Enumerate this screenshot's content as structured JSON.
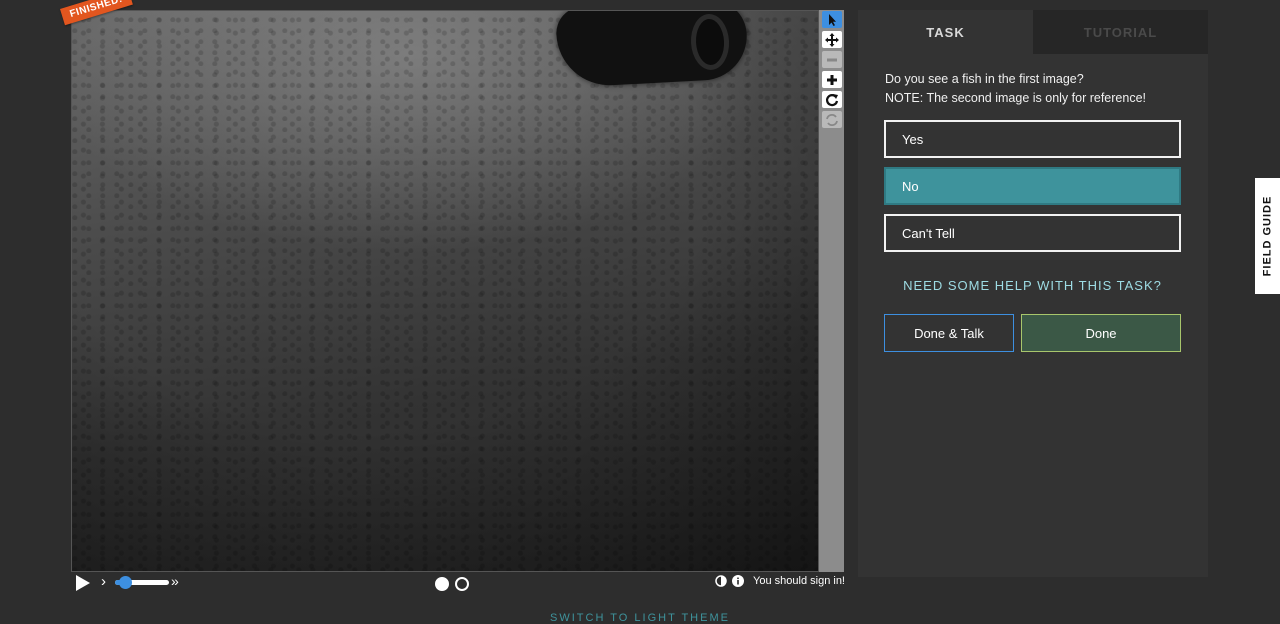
{
  "viewer": {
    "finished_label": "FINISHED!",
    "tools": [
      "pointer-icon",
      "pan-icon",
      "zoom-out-icon",
      "zoom-in-icon",
      "rotate-icon",
      "reset-icon"
    ]
  },
  "controls": {
    "speed_low": "›",
    "speed_high": "»",
    "frames": 2,
    "current_frame": 1,
    "signin_message": "You should sign in!"
  },
  "task": {
    "tabs": [
      {
        "label": "TASK"
      },
      {
        "label": "TUTORIAL"
      }
    ],
    "question_line1": "Do you see a fish in the first image?",
    "question_line2": "NOTE: The second image is only for reference!",
    "answers": [
      {
        "label": "Yes"
      },
      {
        "label": "No"
      },
      {
        "label": "Can't Tell"
      }
    ],
    "selected_answer": "No",
    "help_text": "NEED SOME HELP WITH THIS TASK?",
    "done_talk_label": "Done & Talk",
    "done_label": "Done"
  },
  "field_guide": {
    "label": "FIELD GUIDE"
  },
  "theme_switch": {
    "label": "SWITCH TO LIGHT THEME"
  }
}
